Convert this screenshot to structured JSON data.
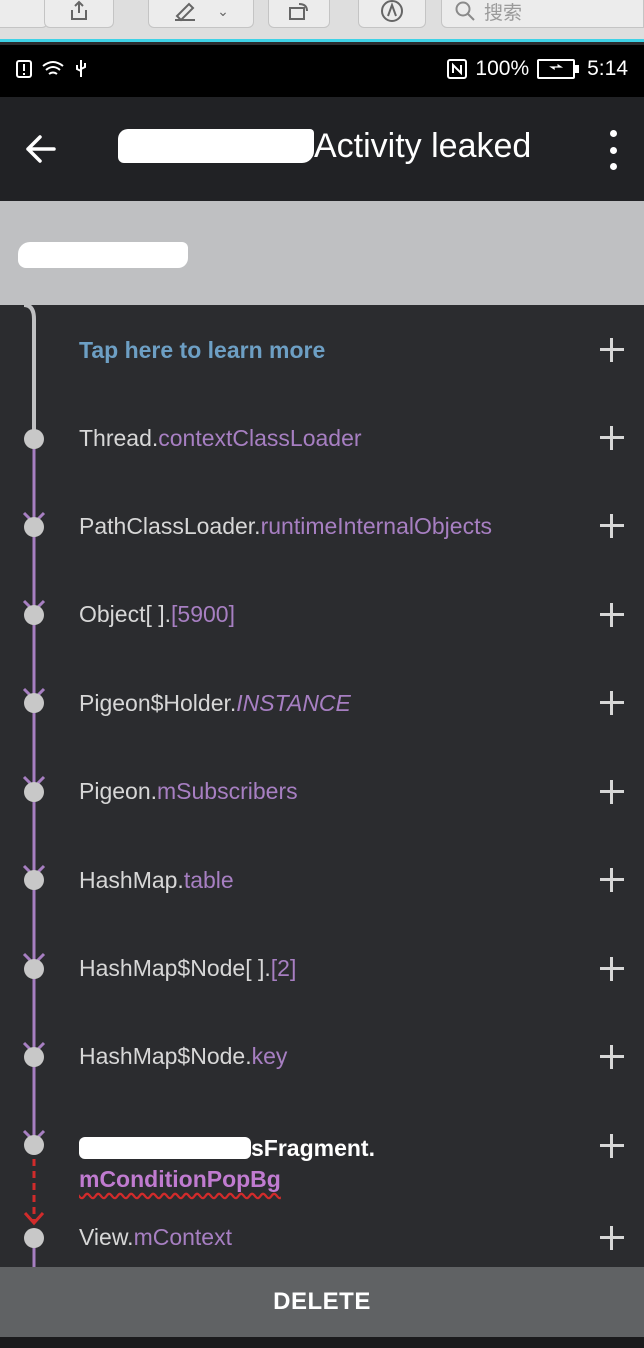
{
  "host_toolbar": {
    "search_placeholder": "搜索"
  },
  "status_bar": {
    "battery_level": "100%",
    "time": "5:14",
    "icons": [
      "alert-icon",
      "wifi-icon",
      "usb-icon",
      "nfc-icon",
      "battery-charging-icon"
    ]
  },
  "app_bar": {
    "title": "Activity leaked",
    "back_icon": "arrow-left-icon",
    "menu_icon": "more-vertical-icon"
  },
  "trace": {
    "learn_more": "Tap here to learn more",
    "items": [
      {
        "cls": "Thread.",
        "field": "contextClassLoader"
      },
      {
        "cls": "PathClassLoader.",
        "field": "runtimeInternalObjects"
      },
      {
        "cls": "Object[ ].",
        "field": "[5900]"
      },
      {
        "cls": "Pigeon$Holder.",
        "field": "INSTANCE"
      },
      {
        "cls": "Pigeon.",
        "field": "mSubscribers"
      },
      {
        "cls": "HashMap.",
        "field": "table"
      },
      {
        "cls": "HashMap$Node[ ].",
        "field": "[2]"
      },
      {
        "cls": "HashMap$Node.",
        "field": "key"
      },
      {
        "cls": "sFragment.",
        "field": "mConditionPopBg"
      },
      {
        "cls": "View.",
        "field": "mContext"
      }
    ]
  },
  "footer": {
    "delete_label": "DELETE"
  },
  "colors": {
    "accent_rail": "#a77fc2",
    "leak_link": "#d12b2b",
    "link": "#6d9fc4"
  }
}
